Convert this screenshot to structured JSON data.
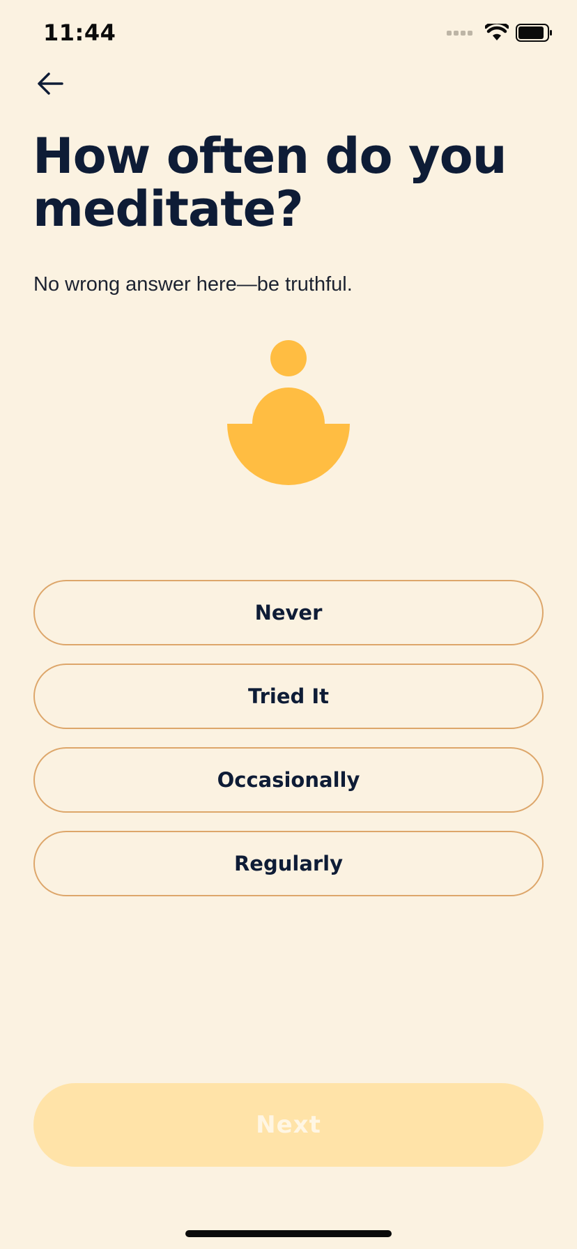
{
  "status_bar": {
    "time": "11:44"
  },
  "header": {
    "back_icon": "arrow-left-icon"
  },
  "question": {
    "title": "How often do you meditate?",
    "subtitle": "No wrong answer here—be truthful."
  },
  "illustration": {
    "icon": "meditating-figure-icon",
    "color": "#FFBD42"
  },
  "options": [
    {
      "label": "Never"
    },
    {
      "label": "Tried It"
    },
    {
      "label": "Occasionally"
    },
    {
      "label": "Regularly"
    }
  ],
  "footer": {
    "next_label": "Next",
    "next_enabled": false
  },
  "colors": {
    "background": "#FBF2E1",
    "text": "#0E1C36",
    "option_border": "#DDA66A",
    "next_disabled_bg": "#FFE3A8"
  }
}
